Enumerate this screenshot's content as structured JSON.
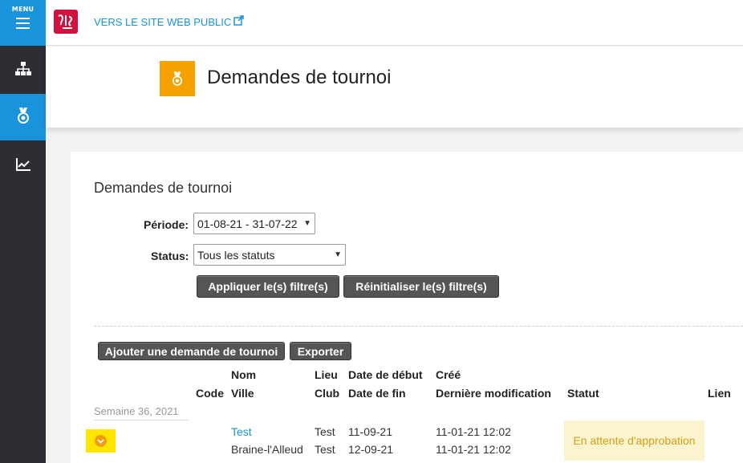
{
  "sidebar": {
    "menu_label": "MENU",
    "items": [
      {
        "icon": "sitemap-icon"
      },
      {
        "icon": "medal-icon",
        "active": true
      },
      {
        "icon": "chart-line-icon"
      }
    ]
  },
  "topbar": {
    "public_link": "VERS LE SITE WEB PUBLIC"
  },
  "header": {
    "title": "Demandes de tournoi"
  },
  "content": {
    "title": "Demandes de tournoi",
    "filters": {
      "period_label": "Période:",
      "period_value": "01-08-21 - 31-07-22",
      "status_label": "Status:",
      "status_value": "Tous les statuts",
      "apply_button": "Appliquer le(s) filtre(s)",
      "reset_button": "Réinitialiser le(s) filtre(s)"
    },
    "actions": {
      "add_button": "Ajouter une demande de tournoi",
      "export_button": "Exporter"
    },
    "table": {
      "headers": {
        "code": "Code",
        "nom": "Nom",
        "ville": "Ville",
        "lieu": "Lieu",
        "club": "Club",
        "date_debut": "Date de début",
        "date_fin": "Date de fin",
        "cree": "Créé",
        "derniere_modif": "Dernière modification",
        "statut": "Statut",
        "lien": "Lien"
      },
      "week_label": "Semaine 36, 2021",
      "rows": [
        {
          "code": "",
          "nom": "Test",
          "ville": "Braine-l'Alleud",
          "lieu": "Test",
          "club": "Test",
          "date_debut": "11-09-21",
          "date_fin": "12-09-21",
          "cree": "11-01-21 12:02",
          "derniere_modif": "11-01-21 12:02",
          "statut": "En attente d'approbation"
        }
      ]
    }
  },
  "colors": {
    "sidebar_bg": "#2c2e33",
    "accent_blue": "#1a93dd",
    "header_icon": "#f5a200",
    "status_bg": "#fcf3cf",
    "status_text": "#d4a017"
  }
}
